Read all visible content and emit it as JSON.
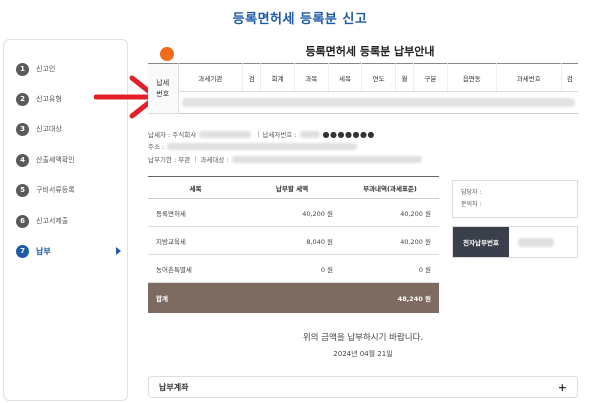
{
  "page_title": "등록면허세 등록분 신고",
  "sidebar": {
    "items": [
      {
        "num": "1",
        "label": "신고인",
        "active": false
      },
      {
        "num": "2",
        "label": "신고유형",
        "active": false
      },
      {
        "num": "3",
        "label": "신고대상",
        "active": false
      },
      {
        "num": "4",
        "label": "산출세액확인",
        "active": false
      },
      {
        "num": "5",
        "label": "구비서류등록",
        "active": false
      },
      {
        "num": "6",
        "label": "신고서제출",
        "active": false
      },
      {
        "num": "7",
        "label": "납부",
        "active": true
      }
    ]
  },
  "main": {
    "title": "등록면허세 등록분 납부안내",
    "tax_table": {
      "row_header": "납세번호",
      "columns": [
        "과세기관",
        "검",
        "회계",
        "과목",
        "세목",
        "연도",
        "월",
        "구분",
        "읍면동",
        "과세번호",
        "검"
      ]
    },
    "info": {
      "taxpayer_label": "납세자 : 주식회사",
      "id_label": "납세자번호 :",
      "id_masked": "●●●●●●●",
      "address_label": "주소 :",
      "due_label": "납부기한 : 무관",
      "target_label": "과세대상 :"
    },
    "amount_table": {
      "headers": [
        "세목",
        "납부할 세액",
        "부과내역(과세표준)"
      ],
      "rows": [
        {
          "item": "등록면허세",
          "amount": "40,200 원",
          "base": "40,200 원"
        },
        {
          "item": "지방교육세",
          "amount": "8,040 원",
          "base": "40,200 원"
        },
        {
          "item": "농어촌특별세",
          "amount": "0 원",
          "base": "0 원"
        }
      ],
      "total": {
        "label": "합계",
        "amount": "48,240 원"
      }
    },
    "contact": {
      "manager_label": "담당자 :",
      "phone_label": "문의처 :"
    },
    "epay": {
      "label": "전자납부번호"
    },
    "notice": "위의 금액을 납부하시기 바랍니다.",
    "date": "2024년 04월 21일",
    "accordion": {
      "label": "납부계좌",
      "icon": "+"
    }
  },
  "colors": {
    "accent": "#1e5aa8",
    "step_inactive": "#5a5a5a",
    "total_row": "#7d6a60",
    "arrow": "#e3202a",
    "dot": "#f26a1b"
  }
}
